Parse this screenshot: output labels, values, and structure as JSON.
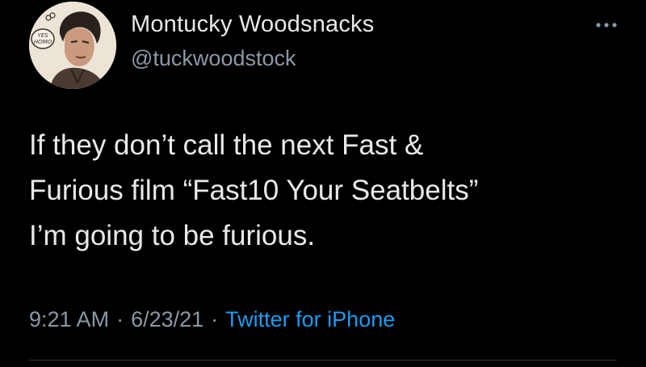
{
  "author": {
    "display_name": "Montucky Woodsnacks",
    "handle": "@tuckwoodstock",
    "avatar_badge_text": "YES HOMO"
  },
  "tweet": {
    "text_lines": [
      "If they don’t call the next Fast &",
      "Furious film “Fast10 Your Seatbelts”",
      "I’m going to be furious."
    ]
  },
  "meta": {
    "time": "9:21 AM",
    "date": "6/23/21",
    "separator": "·",
    "source": "Twitter for iPhone"
  },
  "icons": {
    "more": "more-horizontal-icon"
  },
  "colors": {
    "background": "#000000",
    "primary_text": "#e7e9ea",
    "secondary_text": "#8b98a5",
    "link": "#1d9bf0"
  }
}
